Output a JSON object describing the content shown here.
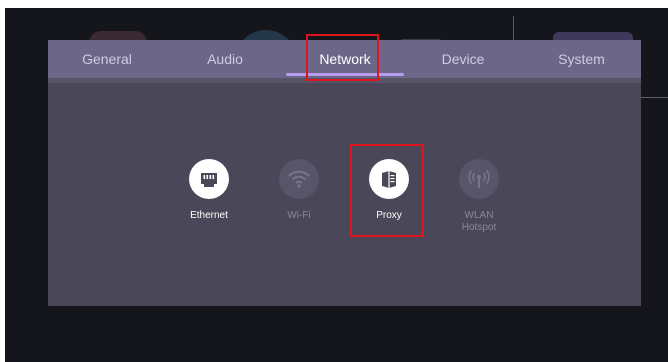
{
  "tabs": [
    {
      "label": "General",
      "active": false
    },
    {
      "label": "Audio",
      "active": false
    },
    {
      "label": "Network",
      "active": true
    },
    {
      "label": "Device",
      "active": false
    },
    {
      "label": "System",
      "active": false
    }
  ],
  "network_options": [
    {
      "label": "Ethernet",
      "icon": "ethernet-icon",
      "enabled": true
    },
    {
      "label": "Wi-Fi",
      "icon": "wifi-icon",
      "enabled": false
    },
    {
      "label": "Proxy",
      "icon": "proxy-icon",
      "enabled": true
    },
    {
      "label": "WLAN\nHotspot",
      "icon": "hotspot-icon",
      "enabled": false
    }
  ],
  "colors": {
    "accent": "#b79cf0",
    "tab_bar": "#6c6688",
    "panel": "#4a4759",
    "highlight": "#e0141e"
  }
}
